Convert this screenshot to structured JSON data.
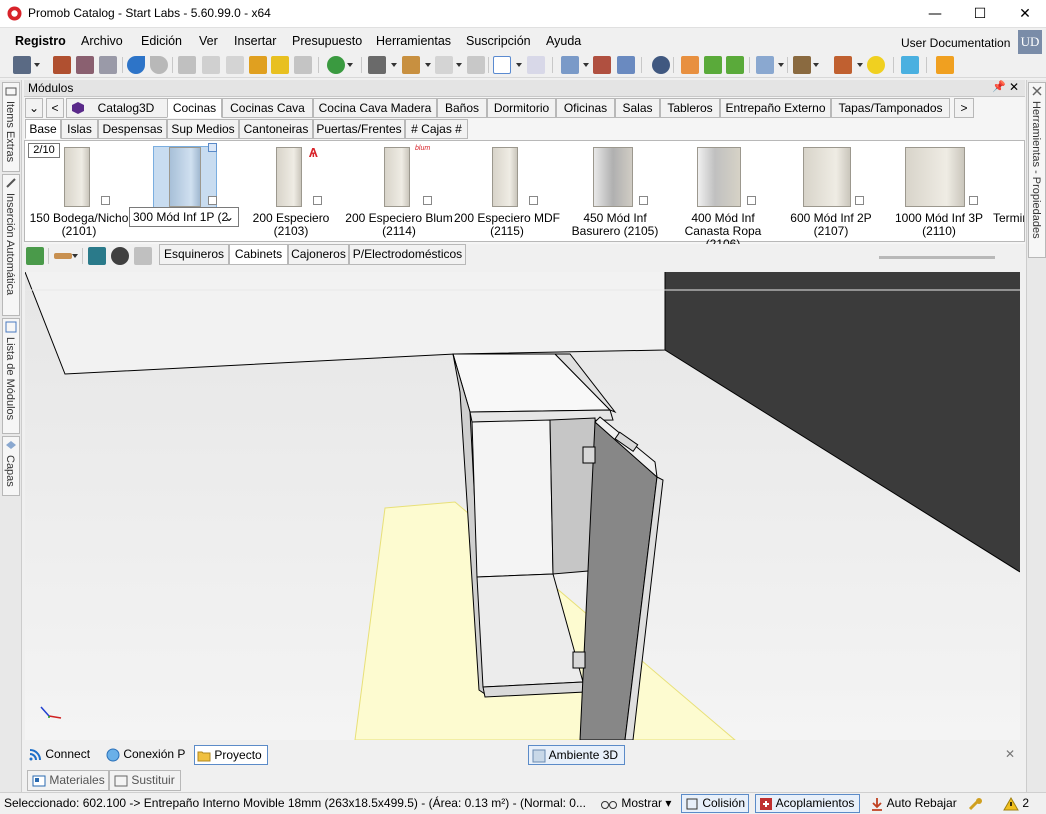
{
  "window": {
    "title": "Promob Catalog - Start Labs - 5.60.99.0 - x64",
    "minimize": "—",
    "maximize": "☐",
    "close": "✕"
  },
  "menu": {
    "items": [
      "Registro",
      "Archivo",
      "Edición",
      "Ver",
      "Insertar",
      "Presupuesto",
      "Herramientas",
      "Suscripción",
      "Ayuda"
    ],
    "user": "User Documentation",
    "avatar": "UD"
  },
  "left_tabs": [
    "Items Extras",
    "Inserción Automática",
    "Lista de Módulos",
    "Capas"
  ],
  "right_tab": "Herramientas - Propiedades",
  "modules": {
    "header": "Módulos",
    "pin": "📌",
    "close": "✕",
    "nav_down": "⌄",
    "nav_left": "<",
    "nav_right": ">",
    "catalog_tabs": [
      "Catalog3D",
      "Cocinas",
      "Cocinas Cava",
      "Cocina Cava Madera",
      "Baños",
      "Dormitorio",
      "Oficinas",
      "Salas",
      "Tableros",
      "Entrepaño Externo",
      "Tapas/Tamponados"
    ],
    "active_catalog": "Cocinas",
    "sub_tabs": [
      "Base",
      "Islas",
      "Despensas",
      "Sup Medios",
      "Cantoneiras",
      "Puertas/Frentes",
      "# Cajas #"
    ],
    "active_sub": "Base",
    "page": "2/10",
    "items": [
      {
        "label": "150 Bodega/Nicho (2101)"
      },
      {
        "label": "300 Mód Inf 1P (2"
      },
      {
        "label": "200 Especiero (2103)"
      },
      {
        "label": "200 Especiero Blum (2114)"
      },
      {
        "label": "200 Especiero MDF (2115)"
      },
      {
        "label": "450 Mód Inf Basurero (2105)"
      },
      {
        "label": "400 Mód Inf Canasta Ropa (2106)"
      },
      {
        "label": "600 Mód Inf 2P (2107)"
      },
      {
        "label": "1000 Mód Inf 3P (2110)"
      },
      {
        "label": "Termin"
      }
    ],
    "section_tabs": [
      "Esquineros",
      "Cabinets",
      "Cajoneros",
      "P/Electrodomésticos"
    ],
    "active_section": "Cabinets",
    "brand_blum": "blum"
  },
  "viewport_bar": {
    "connect": "Connect",
    "conexion": "Conexión P",
    "proyecto": "Proyecto",
    "ambiente": "Ambiente 3D",
    "close": "✕"
  },
  "bottom_tabs": [
    "Materiales",
    "Sustituir"
  ],
  "status": {
    "selection": "Seleccionado: 602.100 -> Entrepaño Interno Movible 18mm (263x18.5x499.5) - (Área: 0.13 m²) - (Normal: 0...",
    "mostrar": "Mostrar",
    "colision": "Colisión",
    "acoplamientos": "Acoplamientos",
    "auto_rebajar": "Auto Rebajar",
    "warnings": "2"
  },
  "colors": {
    "accent": "#1e6fc8",
    "selection": "#c8dcf0",
    "floor_highlight": "#fdfbd0",
    "dark_wall": "#3a3a3a",
    "logo_red": "#d8232a"
  }
}
